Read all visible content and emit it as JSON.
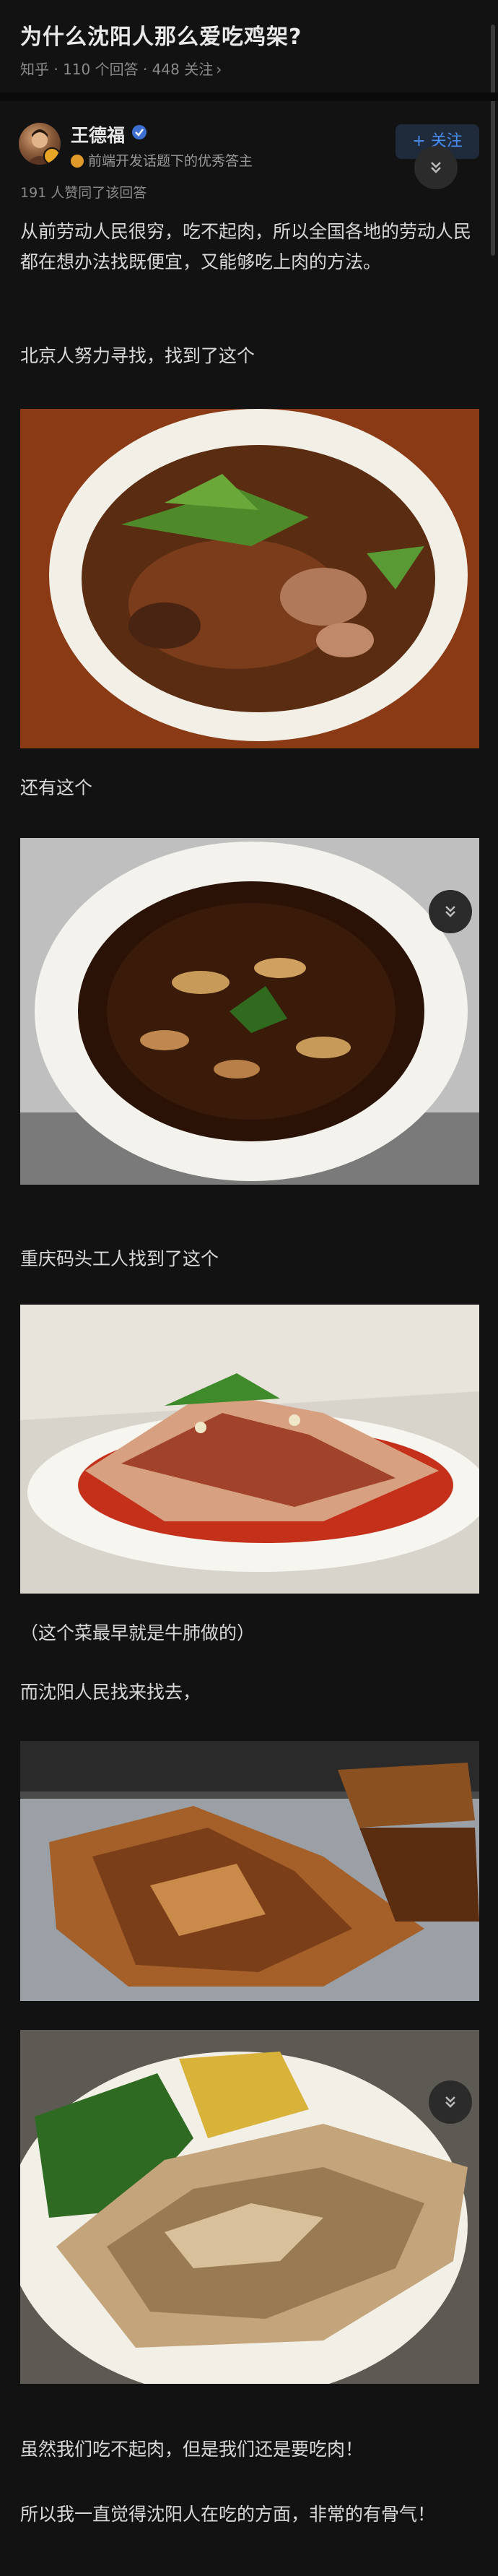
{
  "question": {
    "title": "为什么沈阳人那么爱吃鸡架?",
    "meta": "知乎 · 110 个回答 · 448 关注"
  },
  "author": {
    "name": "王德福",
    "description": "前端开发话题下的优秀答主",
    "follow_label": "+ 关注"
  },
  "answer": {
    "likes": "191 人赞同了该回答",
    "paragraphs": [
      "从前劳动人民很穷，吃不起肉，所以全国各地的劳动人民都在想办法找既便宜，又能够吃上肉的方法。",
      "北京人努力寻找，找到了这个",
      "还有这个",
      "重庆码头工人找到了这个",
      "（这个菜最早就是牛肺做的）",
      "而沈阳人民找来找去，",
      "虽然我们吃不起肉，但是我们还是要吃肉！",
      "所以我一直觉得沈阳人在吃的方面，非常的有骨气！"
    ]
  },
  "icons": {
    "collapse": "double-chevron-down-icon",
    "verified": "verified-badge-icon",
    "medal": "medal-icon"
  },
  "colors": {
    "background": "#121212",
    "text": "#d8d8d8",
    "muted": "#8a8a8a",
    "accent": "#4a8df0"
  }
}
